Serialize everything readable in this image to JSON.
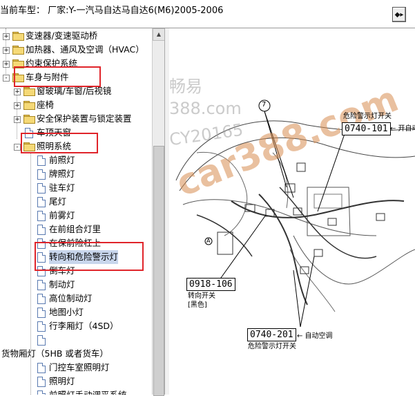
{
  "header": {
    "title": "当前车型： 厂家:Y-一汽马自达马自达6(M6)2005-2006",
    "nav_button_icon": "navigate-icon"
  },
  "tree": {
    "items": [
      {
        "label": "变速器/变速驱动桥",
        "level": 0,
        "type": "folder",
        "expand": "+"
      },
      {
        "label": "加热器、通风及空调（HVAC）",
        "level": 0,
        "type": "folder",
        "expand": "+"
      },
      {
        "label": "约束保护系统",
        "level": 0,
        "type": "folder",
        "expand": "+"
      },
      {
        "label": "车身与附件",
        "level": 0,
        "type": "folder-open",
        "expand": "-"
      },
      {
        "label": "窗玻璃/车窗/后视镜",
        "level": 1,
        "type": "folder",
        "expand": "+"
      },
      {
        "label": "座椅",
        "level": 1,
        "type": "folder",
        "expand": "+"
      },
      {
        "label": "安全保护装置与锁定装置",
        "level": 1,
        "type": "folder",
        "expand": "+"
      },
      {
        "label": "车顶天窗",
        "level": 1,
        "type": "page",
        "expand": ""
      },
      {
        "label": "照明系统",
        "level": 1,
        "type": "folder-open",
        "expand": "-"
      },
      {
        "label": "前照灯",
        "level": 2,
        "type": "page"
      },
      {
        "label": "牌照灯",
        "level": 2,
        "type": "page"
      },
      {
        "label": "驻车灯",
        "level": 2,
        "type": "page"
      },
      {
        "label": "尾灯",
        "level": 2,
        "type": "page"
      },
      {
        "label": "前雾灯",
        "level": 2,
        "type": "page"
      },
      {
        "label": "在前组合灯里",
        "level": 2,
        "type": "page"
      },
      {
        "label": "在保前险杠上",
        "level": 2,
        "type": "page"
      },
      {
        "label": "转向和危险警示灯",
        "level": 2,
        "type": "page",
        "selected": true
      },
      {
        "label": "倒车灯",
        "level": 2,
        "type": "page"
      },
      {
        "label": "制动灯",
        "level": 2,
        "type": "page"
      },
      {
        "label": "高位制动灯",
        "level": 2,
        "type": "page"
      },
      {
        "label": "地图小灯",
        "level": 2,
        "type": "page"
      },
      {
        "label": "行李厢灯（4SD）",
        "level": 2,
        "type": "page"
      },
      {
        "label": "",
        "level": 2,
        "type": "page"
      },
      {
        "label": "货物厢灯（5HB 或者货车）",
        "level": -1,
        "type": "text"
      },
      {
        "label": "门控车室照明灯",
        "level": 2,
        "type": "page"
      },
      {
        "label": "照明灯",
        "level": 2,
        "type": "page"
      },
      {
        "label": "前照灯手动调平系统",
        "level": 2,
        "type": "page"
      }
    ]
  },
  "diagram": {
    "callout_top": "0740-101",
    "callout_top_caption": "危险警示灯开关",
    "callout_top_arrow": "← 开自动空",
    "callout_left": "0918-106",
    "callout_left_caption1": "转向开关",
    "callout_left_caption2": "[黑色]",
    "callout_bottom": "0740-201",
    "callout_bottom_arrow": "← 自动空调",
    "callout_bottom_caption": "危险警示灯开关",
    "circle_marker": "7",
    "small_marker": "A",
    "watermarks": [
      "畅易",
      "388.com",
      "CY20165",
      "car388.com"
    ]
  }
}
